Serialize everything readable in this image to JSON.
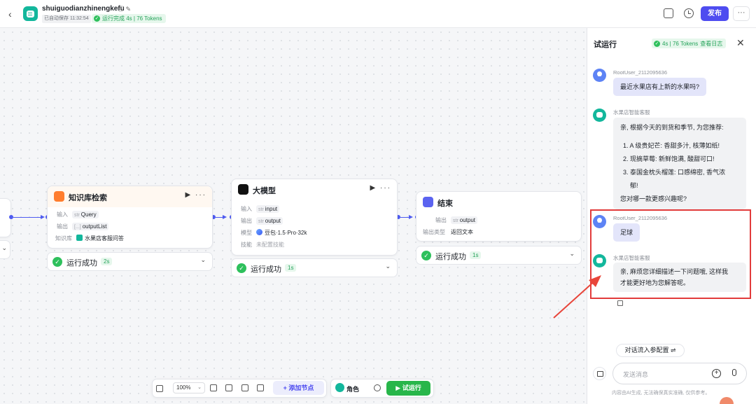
{
  "header": {
    "app_name": "shuiguodianzhinengkefu",
    "autosave": "已自动保存 11:32:54",
    "run_status": "运行完成 4s | 76 Tokens",
    "publish": "发布",
    "more": "···"
  },
  "nodes": {
    "knowledge": {
      "title": "知识库检索",
      "input_label": "输入",
      "input_type": "str",
      "input_value": "Query",
      "output_label": "输出",
      "output_type": "[...]",
      "output_value": "outputList",
      "kb_label": "知识库",
      "kb_value": "水果店客服问答",
      "status": "运行成功",
      "duration": "2s"
    },
    "llm": {
      "title": "大模型",
      "input_label": "输入",
      "input_type": "str",
      "input_value": "input",
      "output_label": "输出",
      "output_type": "str",
      "output_value": "output",
      "model_label": "模型",
      "model_value": "豆包·1.5·Pro·32k",
      "skill_label": "技能",
      "skill_value": "未配置技能",
      "status": "运行成功",
      "duration": "1s"
    },
    "end": {
      "title": "结束",
      "output_label": "输出",
      "output_type": "str",
      "output_value": "output",
      "otype_label": "输出类型",
      "otype_value": "返回文本",
      "status": "运行成功",
      "duration": "1s"
    }
  },
  "toolbar": {
    "zoom": "100%",
    "add_node": "+ 添加节点",
    "role": "角色",
    "trial_run": "▶ 试运行"
  },
  "panel": {
    "title": "试运行",
    "badge_stats": "4s | 76 Tokens",
    "badge_log": "查看日志",
    "messages": [
      {
        "role": "user",
        "name": "RootUser_2112095636",
        "text": "最近水果店有上新的水果吗?"
      },
      {
        "role": "bot",
        "name": "水果店智能客服",
        "intro": "亲, 根据今天的到货和季节, 为您推荐:",
        "items": [
          "1. A 级贵妃芒: 香甜多汁, 核薄如纸!",
          "2. 现摘草莓: 新鲜饱满, 酸甜可口!",
          "3. 泰国金枕头榴莲: 口感绵密, 香气浓",
          "郁!"
        ],
        "outro": "您对哪一款更感兴趣呢?"
      },
      {
        "role": "user",
        "name": "RootUser_2112095636",
        "text": "足球"
      },
      {
        "role": "bot",
        "name": "水果店智能客服",
        "text_l1": "亲, 麻烦您详细描述一下问题哦, 这样我",
        "text_l2": "才能更好地为您解答呢。"
      }
    ],
    "config_button": "对话流入参配置",
    "input_placeholder": "发送消息",
    "disclaimer": "内容由AI生成, 无法确保真实准确, 仅供参考。"
  },
  "colors": {
    "brand": "#4e4cf0",
    "success": "#2ec05c",
    "edge": "#4e5bf0",
    "highlight": "#e23b3b"
  }
}
